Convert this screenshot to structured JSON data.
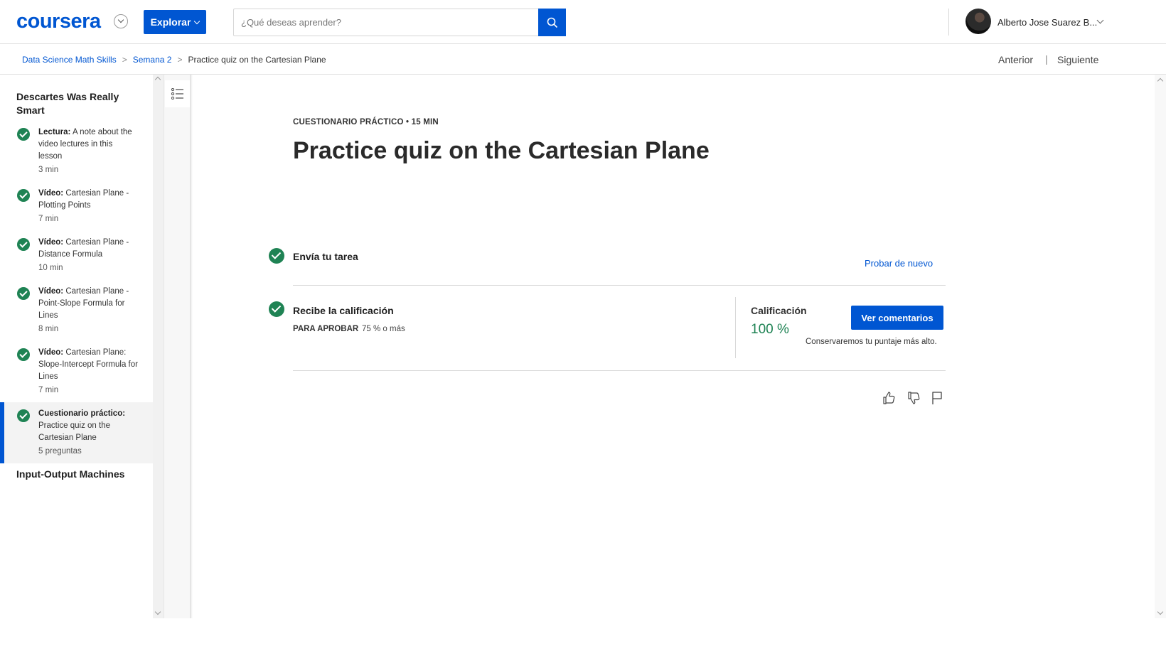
{
  "header": {
    "logo": "coursera",
    "explore_label": "Explorar",
    "search_placeholder": "¿Qué deseas aprender?",
    "user_name": "Alberto Jose Suarez B..."
  },
  "breadcrumb": {
    "items": [
      "Data Science Math Skills",
      "Semana 2",
      "Practice quiz on the Cartesian Plane"
    ],
    "separator": ">",
    "prev_label": "Anterior",
    "divider": "|",
    "next_label": "Siguiente"
  },
  "sidebar": {
    "section_title": "Descartes Was Really Smart",
    "items": [
      {
        "type": "Lectura:",
        "title": "A note about the video lectures in this lesson",
        "duration": "3 min"
      },
      {
        "type": "Vídeo:",
        "title": "Cartesian Plane - Plotting Points",
        "duration": "7 min"
      },
      {
        "type": "Vídeo:",
        "title": "Cartesian Plane - Distance Formula",
        "duration": "10 min"
      },
      {
        "type": "Vídeo:",
        "title": "Cartesian Plane - Point-Slope Formula for Lines",
        "duration": "8 min"
      },
      {
        "type": "Vídeo:",
        "title": "Cartesian Plane: Slope-Intercept Formula for Lines",
        "duration": "7 min"
      },
      {
        "type": "Cuestionario práctico:",
        "title": "Practice quiz on the Cartesian Plane",
        "duration": "5 preguntas"
      }
    ],
    "next_section_title": "Input-Output Machines"
  },
  "main": {
    "eyebrow": "CUESTIONARIO PRÁCTICO • 15 MIN",
    "title": "Practice quiz on the Cartesian Plane",
    "step1_title": "Envía tu tarea",
    "retry_label": "Probar de nuevo",
    "step2_title": "Recibe la calificación",
    "pass_label": "PARA APROBAR",
    "pass_value": "75 % o más",
    "grade_label": "Calificación",
    "grade_value": "100 %",
    "feedback_label": "Ver comentarios",
    "keep_note": "Conservaremos tu puntaje más alto."
  },
  "colors": {
    "brand": "#0056d2",
    "success": "#1f8354"
  }
}
